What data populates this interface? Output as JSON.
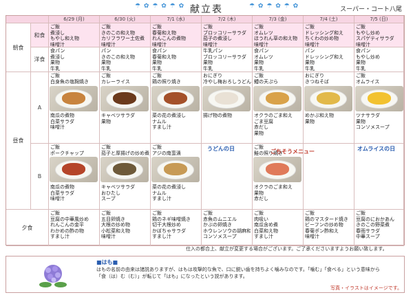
{
  "header": {
    "title": "献立表",
    "store": "スーパー・コート八尾",
    "deco_left": "☂ ✿ ☂ ✿ ☂ ✿",
    "deco_right": "☂ ✿ ☂ ✿ ☂ ✿"
  },
  "dates": [
    "6/29 (月)",
    "6/30 (火)",
    "7/1 (水)",
    "7/2 (木)",
    "7/3 (金)",
    "7/4 (土)",
    "7/5 (日)"
  ],
  "labels": {
    "breakfast": "朝食",
    "washoku": "和食",
    "yoshoku": "洋食",
    "lunch": "昼食",
    "a": "A",
    "b": "B",
    "dinner": "夕食"
  },
  "breakfast_wa": [
    [
      "ご飯",
      "煮浸し",
      "もやし和え物",
      "味噌汁"
    ],
    [
      "ご飯",
      "きのこの和え物",
      "カリフラワー土佐煮",
      "味噌汁"
    ],
    [
      "ご飯",
      "春菊和え物",
      "れんこんの煮物",
      "味噌汁"
    ],
    [
      "ご飯",
      "ブロッコリーサラダ",
      "茄子の煮浸し",
      "味噌汁"
    ],
    [
      "ご飯",
      "オムレツ",
      "ほうれん草の和え物",
      "味噌汁"
    ],
    [
      "ご飯",
      "ドレッシング和え",
      "ちくわの炒め物",
      "味噌汁"
    ],
    [
      "ご飯",
      "もやし炒め",
      "スパゲティサラダ",
      "味噌汁"
    ]
  ],
  "breakfast_yo": [
    [
      "食パン",
      "煮浸し",
      "果物",
      "牛乳"
    ],
    [
      "パン",
      "きのこの和え物",
      "果物",
      "牛乳"
    ],
    [
      "食パン",
      "春菊和え物",
      "果物",
      "牛乳"
    ],
    [
      "牛乳パン",
      "ブロッコリーサラダ",
      "果物",
      "牛乳"
    ],
    [
      "食パン",
      "オムレツ",
      "果物",
      "牛乳"
    ],
    [
      "パン",
      "ドレッシング和え",
      "果物",
      "牛乳"
    ],
    [
      "食パン",
      "もやし炒め",
      "果物",
      "牛乳"
    ]
  ],
  "lunch_a_top": [
    [
      "ご飯",
      "白身魚の塩麹焼き"
    ],
    [
      "ご飯",
      "カレーライス"
    ],
    [
      "ご飯",
      "鶏の照り焼き"
    ],
    [
      "おにぎり",
      "冷やし梅おろしうどん"
    ],
    [
      "ご飯",
      "鱧の天ぷら"
    ],
    [
      "おにぎり",
      "きつねそば"
    ],
    [
      "ご飯",
      "オムライス"
    ]
  ],
  "lunch_a_bottom": [
    [
      "南瓜の煮物",
      "白菜サラダ",
      "味噌汁"
    ],
    [
      "キャベツサラダ",
      "果物"
    ],
    [
      "菜の花の煮浸し",
      "ナムル",
      "すまし汁"
    ],
    [
      "揚げ物の煮物"
    ],
    [
      "オクラのごま和え",
      "ごま豆腐",
      "赤だし",
      "果物"
    ],
    [
      "めかぶ和え物",
      "果物"
    ],
    [
      "ツナサラダ",
      "果物",
      "コンソメスープ"
    ]
  ],
  "lunch_b_top": [
    [
      "ご飯",
      "ポークチャップ"
    ],
    [
      "ご飯",
      "茄子と厚揚げの炒め煮"
    ],
    [
      "ご飯",
      "アジの南蛮漬"
    ],
    [],
    [
      "ご飯",
      "鮭の照り焼き"
    ],
    [],
    []
  ],
  "lunch_b_bottom": [
    [
      "南瓜の煮物",
      "白菜サラダ",
      "味噌汁"
    ],
    [
      "キャベツサラダ",
      "おひたし",
      "スープ"
    ],
    [
      "菜の花の煮浸し",
      "ナムル",
      "すまし汁"
    ],
    [],
    [
      "オクラのごま和え",
      "果物",
      "赤だし"
    ],
    [],
    []
  ],
  "dinner": [
    [
      "ご飯",
      "豆腐の中華風炒め",
      "れんこんの金平",
      "わかめの酢の物",
      "すまし汁"
    ],
    [
      "ご飯",
      "五目卵焼き",
      "大根の炒め物",
      "小松菜和え物",
      "味噌汁"
    ],
    [
      "ご飯",
      "鶏のネギ味噌焼き",
      "切干大根炒め",
      "かぼちゃサラダ",
      "すまし汁"
    ],
    [
      "ご飯",
      "赤魚のムニエル",
      "かぶの卵焼き",
      "ホウレンソウの胡麻和え",
      "コンソメスープ"
    ],
    [
      "ご飯",
      "肉吸い",
      "南瓜含め煮",
      "白菜和え物",
      "すまし汁"
    ],
    [
      "ご飯",
      "鶏のマスタード焼き",
      "ビーフンの炒め物",
      "春菊ポン酢和え",
      "味噌汁"
    ],
    [
      "ご飯",
      "豆腐のにおかあん",
      "きのこの野菜煮",
      "春雨サラダ",
      "中華スープ"
    ]
  ],
  "callouts": {
    "udon": "うどんの日",
    "gochisou": "ごちそうメニュー",
    "omurice": "オムライスの日"
  },
  "footer_note": "仕入の都合上、献立が変更する場合がございます。ご了承くださいますようお願い致します。",
  "hamo": {
    "title": "■はも■",
    "text": "はもの名前の由来は諸説ありますが、はもは攻撃的な魚で、口に鋭い歯を持ちよく噛みなのです。「噛む」「食べる」という意味から「食（は）む（む）」が転じて「はも」になったという説があります。"
  },
  "photo_note": "写真・イラストはイメージです。",
  "colors": {
    "header_pink": "#f7d5e3",
    "breakfast_pink": "#fde3ef",
    "accent_blue": "#2a5db0",
    "callout_red": "#c0392b"
  }
}
